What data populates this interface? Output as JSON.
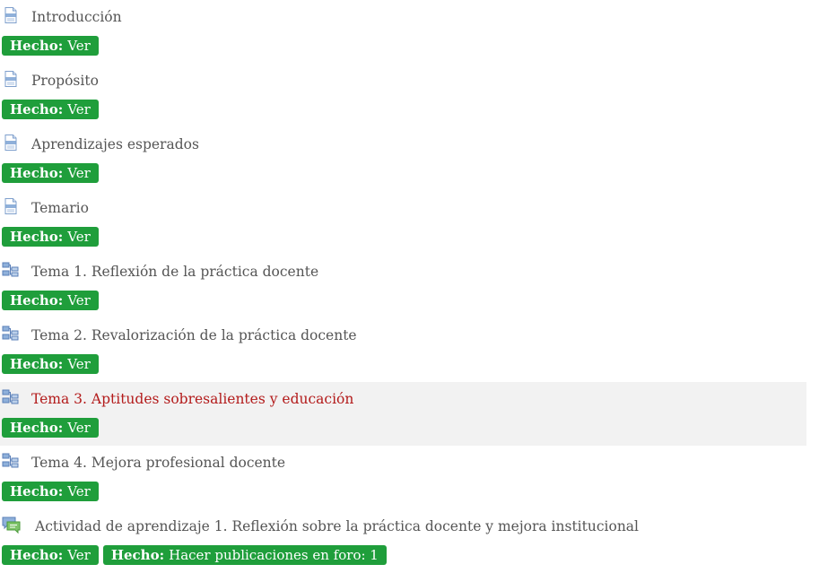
{
  "colors": {
    "badge_bg": "#1f9e3b",
    "badge_text": "#ffffff",
    "title_text": "#555555",
    "highlight_title": "#b31b1b",
    "highlight_bg": "#f2f2f2"
  },
  "activities": [
    {
      "title": "Introducción",
      "icon": "page-icon",
      "highlighted": false,
      "badges": [
        {
          "strong": "Hecho:",
          "text": "Ver"
        }
      ]
    },
    {
      "title": "Propósito",
      "icon": "page-icon",
      "highlighted": false,
      "badges": [
        {
          "strong": "Hecho:",
          "text": "Ver"
        }
      ]
    },
    {
      "title": "Aprendizajes esperados",
      "icon": "page-icon",
      "highlighted": false,
      "badges": [
        {
          "strong": "Hecho:",
          "text": "Ver"
        }
      ]
    },
    {
      "title": "Temario",
      "icon": "page-icon",
      "highlighted": false,
      "badges": [
        {
          "strong": "Hecho:",
          "text": "Ver"
        }
      ]
    },
    {
      "title": "Tema 1. Reflexión de la práctica docente",
      "icon": "book-icon",
      "highlighted": false,
      "badges": [
        {
          "strong": "Hecho:",
          "text": "Ver"
        }
      ]
    },
    {
      "title": "Tema 2. Revalorización de la práctica docente",
      "icon": "book-icon",
      "highlighted": false,
      "badges": [
        {
          "strong": "Hecho:",
          "text": "Ver"
        }
      ]
    },
    {
      "title": "Tema 3. Aptitudes sobresalientes y educación",
      "icon": "book-icon",
      "highlighted": true,
      "badges": [
        {
          "strong": "Hecho:",
          "text": "Ver"
        }
      ]
    },
    {
      "title": "Tema 4. Mejora profesional docente",
      "icon": "book-icon",
      "highlighted": false,
      "badges": [
        {
          "strong": "Hecho:",
          "text": "Ver"
        }
      ]
    },
    {
      "title": "Actividad de aprendizaje 1. Reflexión sobre la práctica docente y mejora institucional",
      "icon": "forum-icon",
      "highlighted": false,
      "badges": [
        {
          "strong": "Hecho:",
          "text": "Ver"
        },
        {
          "strong": "Hecho:",
          "text": "Hacer publicaciones en foro: 1"
        }
      ]
    }
  ]
}
